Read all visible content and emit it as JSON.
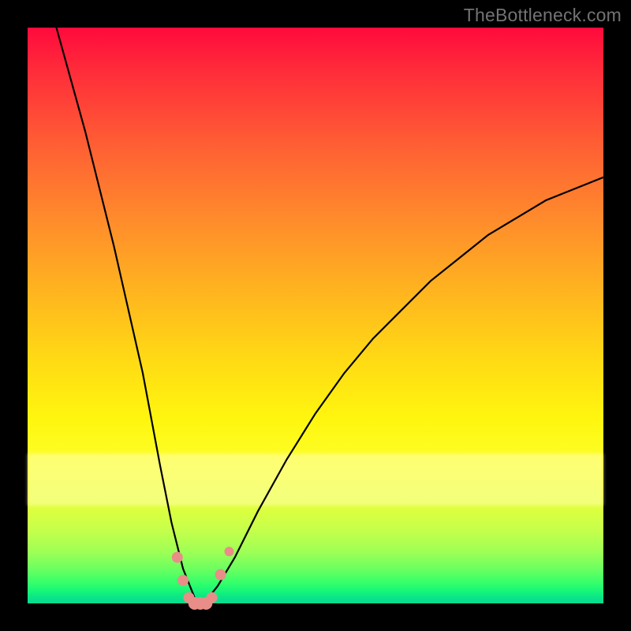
{
  "watermark": {
    "text": "TheBottleneck.com"
  },
  "chart_data": {
    "type": "line",
    "title": "",
    "xlabel": "",
    "ylabel": "",
    "xlim": [
      0,
      100
    ],
    "ylim": [
      0,
      100
    ],
    "grid": false,
    "legend": false,
    "background_gradient": [
      "#ff0a3c",
      "#ff8a2c",
      "#ffdb14",
      "#fcff2a",
      "#9fff55",
      "#09db8e"
    ],
    "series": [
      {
        "name": "bottleneck-curve",
        "color": "#000000",
        "x": [
          5,
          10,
          15,
          20,
          23,
          25,
          27,
          29,
          30,
          31,
          33,
          36,
          40,
          45,
          50,
          55,
          60,
          65,
          70,
          75,
          80,
          85,
          90,
          95,
          100
        ],
        "values": [
          100,
          82,
          62,
          40,
          24,
          14,
          6,
          1,
          0,
          0.5,
          3,
          8,
          16,
          25,
          33,
          40,
          46,
          51,
          56,
          60,
          64,
          67,
          70,
          72,
          74
        ]
      }
    ],
    "markers": [
      {
        "x": 26,
        "y": 8,
        "color": "#e98d89",
        "r": 7
      },
      {
        "x": 27,
        "y": 4,
        "color": "#e98d89",
        "r": 7
      },
      {
        "x": 28,
        "y": 1,
        "color": "#e98d89",
        "r": 7
      },
      {
        "x": 29,
        "y": 0,
        "color": "#e98d89",
        "r": 8
      },
      {
        "x": 30,
        "y": 0,
        "color": "#e98d89",
        "r": 8
      },
      {
        "x": 31,
        "y": 0,
        "color": "#e98d89",
        "r": 8
      },
      {
        "x": 32,
        "y": 1,
        "color": "#e98d89",
        "r": 7
      },
      {
        "x": 33.5,
        "y": 5,
        "color": "#e98d89",
        "r": 7
      },
      {
        "x": 35,
        "y": 9,
        "color": "#e98d89",
        "r": 6
      }
    ]
  }
}
